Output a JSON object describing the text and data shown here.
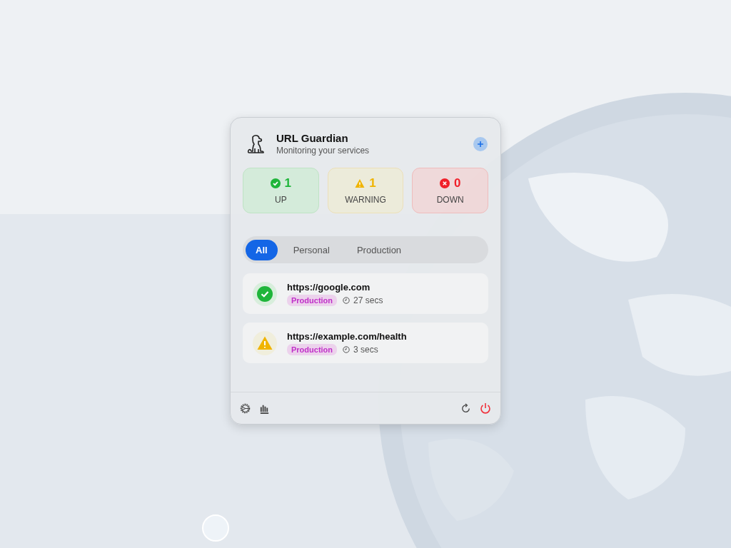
{
  "header": {
    "title": "URL Guardian",
    "subtitle": "Monitoring your services"
  },
  "stats": [
    {
      "kind": "up",
      "count": "1",
      "label": "UP"
    },
    {
      "kind": "warning",
      "count": "1",
      "label": "WARNING"
    },
    {
      "kind": "down",
      "count": "0",
      "label": "DOWN"
    }
  ],
  "tabs": [
    {
      "label": "All",
      "selected": true
    },
    {
      "label": "Personal",
      "selected": false
    },
    {
      "label": "Production",
      "selected": false
    }
  ],
  "monitors": [
    {
      "url": "https://google.com",
      "kind": "up",
      "tag": "Production",
      "age": "27 secs"
    },
    {
      "url": "https://example.com/health",
      "kind": "warning",
      "tag": "Production",
      "age": "3 secs"
    }
  ]
}
